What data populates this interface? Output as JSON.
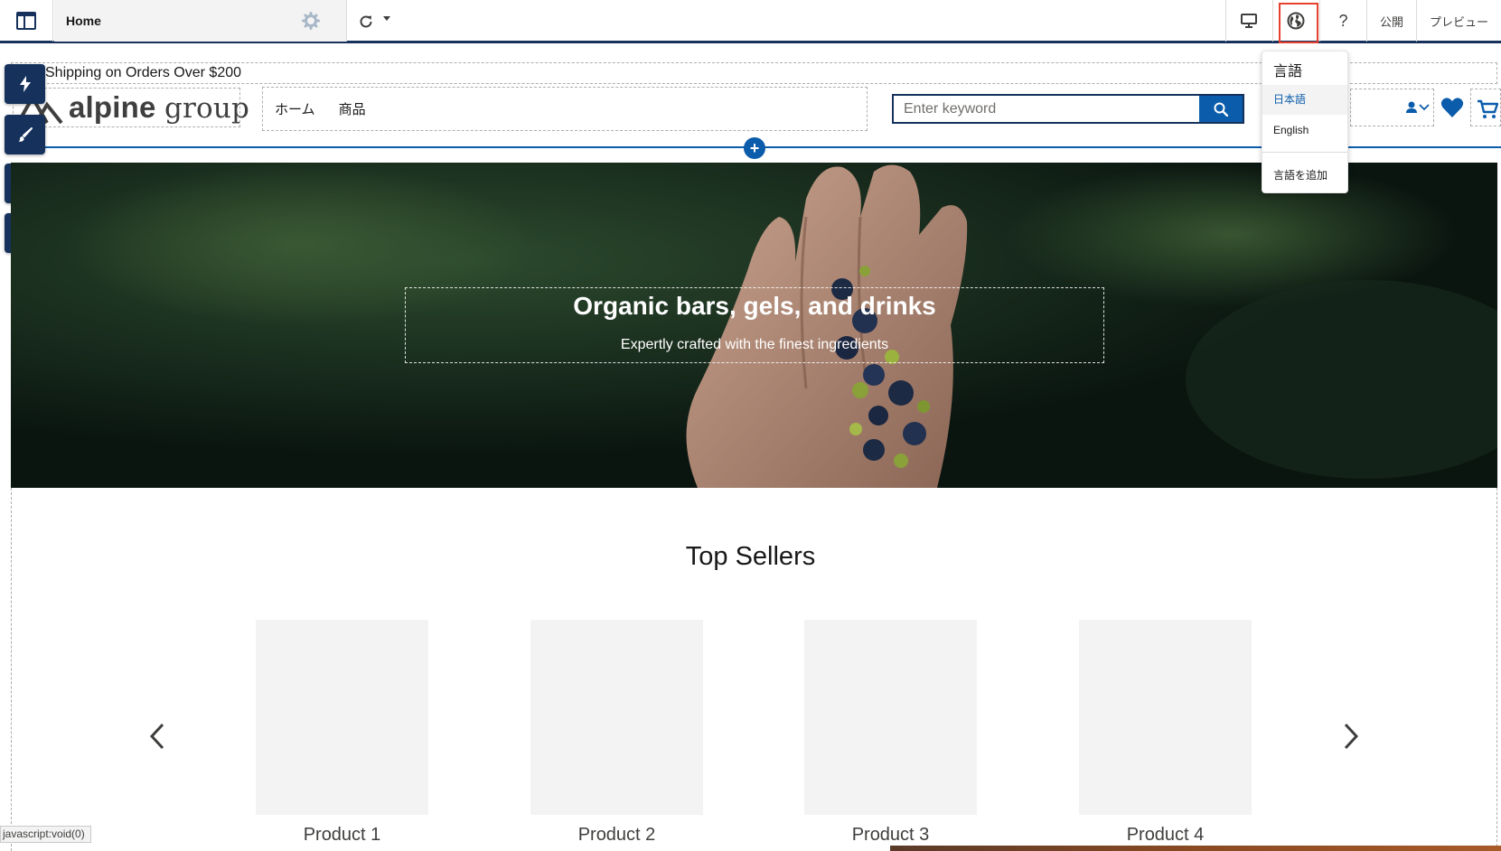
{
  "toolbar": {
    "page_name": "Home",
    "publish_label": "公開",
    "preview_label": "プレビュー",
    "help_label": "?"
  },
  "language_menu": {
    "header": "言語",
    "items": [
      "日本語",
      "English"
    ],
    "selected": "日本語",
    "add_label": "言語を追加"
  },
  "site_header": {
    "announcement": "Shipping on Orders Over $200",
    "logo_bold": "alpine",
    "logo_light": "group",
    "nav_items": [
      "ホーム",
      "商品"
    ],
    "search_placeholder": "Enter keyword"
  },
  "left_panel": {
    "settings_label": "設定"
  },
  "hero": {
    "title": "Organic bars, gels, and drinks",
    "subtitle": "Expertly crafted with the finest ingredients"
  },
  "top_sellers": {
    "title": "Top Sellers",
    "products": [
      "Product 1",
      "Product 2",
      "Product 3",
      "Product 4"
    ]
  },
  "status_bar": "javascript:void(0)",
  "colors": {
    "navy": "#16325c",
    "brand_blue": "#0b5cab",
    "highlight_red": "#e8402f"
  }
}
